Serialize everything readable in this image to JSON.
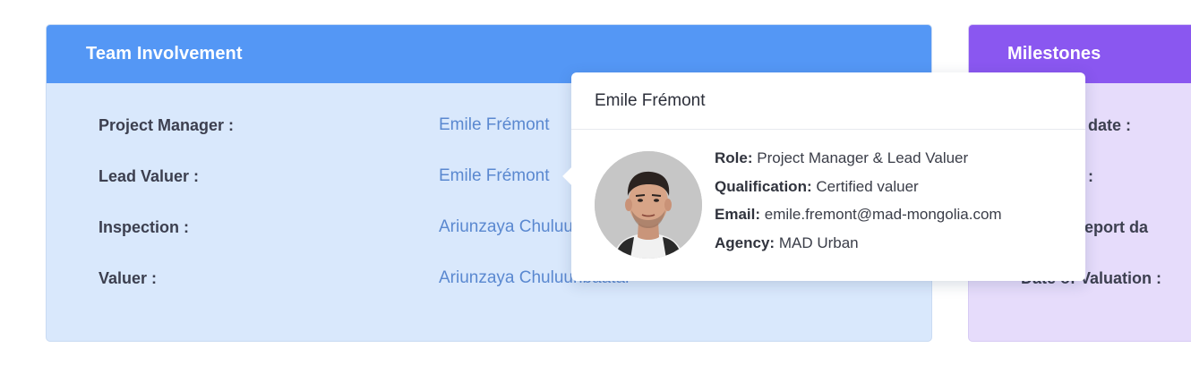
{
  "team": {
    "title": "Team Involvement",
    "rows": [
      {
        "label": "Project Manager :",
        "value": "Emile Frémont"
      },
      {
        "label": "Lead Valuer :",
        "value": "Emile Frémont"
      },
      {
        "label": "Inspection :",
        "value": "Ariunzaya Chuluunbaatar"
      },
      {
        "label": "Valuer :",
        "value": "Ariunzaya Chuluunbaatar"
      }
    ]
  },
  "milestones": {
    "title": "Milestones",
    "rows": [
      {
        "label": "...tion date :"
      },
      {
        "label": "...tion :"
      },
      {
        "label": "...on report da"
      },
      {
        "label": "Date of Valuation :"
      }
    ]
  },
  "popover": {
    "name": "Emile Frémont",
    "role_key": "Role:",
    "role": "Project Manager & Lead Valuer",
    "qualification_key": "Qualification:",
    "qualification": "Certified valuer",
    "email_key": "Email:",
    "email": "emile.fremont@mad-mongolia.com",
    "agency_key": "Agency:",
    "agency": "MAD Urban"
  },
  "colors": {
    "team_header": "#5497f5",
    "team_body": "#d9e8fc",
    "milestones_header": "#8a57f0",
    "milestones_body": "#e6dcfb",
    "link": "#5a88d0"
  }
}
